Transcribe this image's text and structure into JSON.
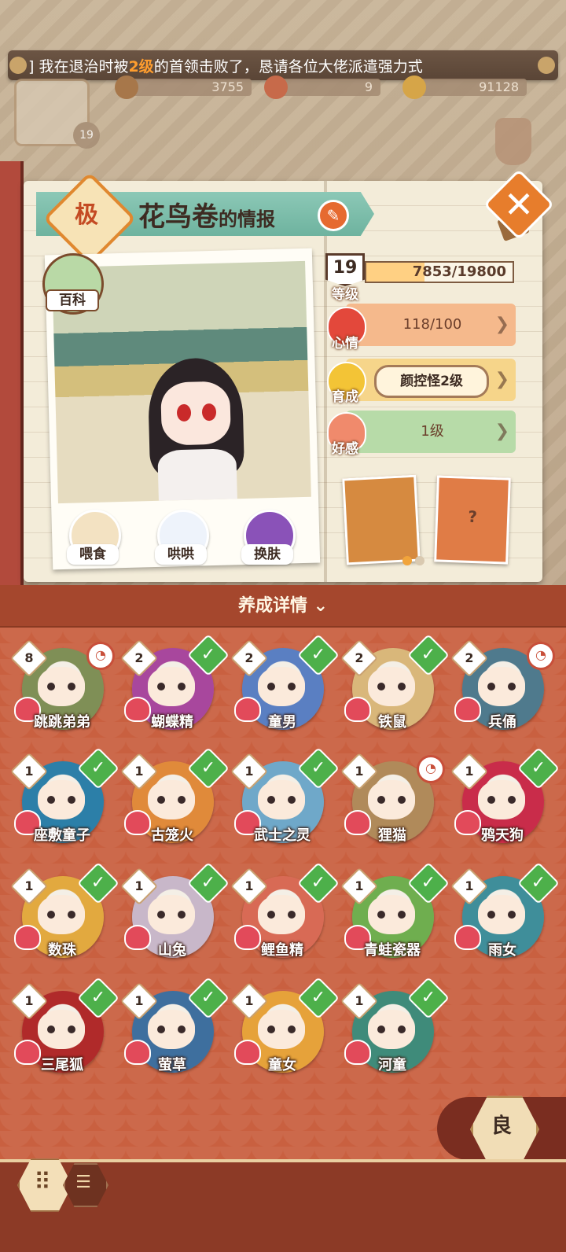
{
  "notice": {
    "prefix": "] 我在退治时被",
    "highlight": "2级",
    "suffix": "的首领击败了，恳请各位大佬派遣强力式"
  },
  "resources": {
    "food": "3755",
    "tickets": "9",
    "coins": "91128",
    "player_level": "19"
  },
  "info": {
    "grade": "极",
    "name": "花鸟卷",
    "name_suffix": "的情报",
    "edit_icon": "pencil-icon",
    "close_icon": "close-icon"
  },
  "photo": {
    "baike_label": "百科",
    "actions": [
      {
        "label": "喂食",
        "icon": "noodle-bowl-icon"
      },
      {
        "label": "哄哄",
        "icon": "milk-carton-icon"
      },
      {
        "label": "换肤",
        "icon": "skin-box-icon"
      }
    ]
  },
  "stats": {
    "level_label": "等级",
    "level": "19",
    "exp": "7853/19800",
    "exp_fraction": 0.3966,
    "mood_label": "心情",
    "mood": "118/100",
    "nurture_label": "育成",
    "nurture": "颜控怪2级",
    "affinity_label": "好感",
    "affinity": "1级"
  },
  "carousel": {
    "page": 1,
    "pages": 2
  },
  "detail_title": "养成详情",
  "shikigami": [
    {
      "name": "跳跳弟弟",
      "level": "8",
      "status": "lock",
      "color": "#7f8f56"
    },
    {
      "name": "蝴蝶精",
      "level": "2",
      "status": "check",
      "color": "#a8479d"
    },
    {
      "name": "童男",
      "level": "2",
      "status": "check",
      "color": "#5a7fc2"
    },
    {
      "name": "铁鼠",
      "level": "2",
      "status": "check",
      "color": "#d9b77a"
    },
    {
      "name": "兵俑",
      "level": "2",
      "status": "lock",
      "color": "#4f7a8d"
    },
    {
      "name": "座敷童子",
      "level": "1",
      "status": "check",
      "color": "#2c7fa8"
    },
    {
      "name": "古笼火",
      "level": "1",
      "status": "check",
      "color": "#e08a3a"
    },
    {
      "name": "武士之灵",
      "level": "1",
      "status": "check",
      "color": "#6fa8c9"
    },
    {
      "name": "狸猫",
      "level": "1",
      "status": "lock",
      "color": "#b08a5a"
    },
    {
      "name": "鸦天狗",
      "level": "1",
      "status": "check",
      "color": "#c92c4a"
    },
    {
      "name": "数珠",
      "level": "1",
      "status": "check",
      "color": "#e2a93f"
    },
    {
      "name": "山兔",
      "level": "1",
      "status": "check",
      "color": "#c8b7c9"
    },
    {
      "name": "鲤鱼精",
      "level": "1",
      "status": "check",
      "color": "#d86a55"
    },
    {
      "name": "青蛙瓷器",
      "level": "1",
      "status": "check",
      "color": "#6fae4f"
    },
    {
      "name": "雨女",
      "level": "1",
      "status": "check",
      "color": "#3f8e9a"
    },
    {
      "name": "三尾狐",
      "level": "1",
      "status": "check",
      "color": "#b02a2a"
    },
    {
      "name": "萤草",
      "level": "1",
      "status": "check",
      "color": "#3e6f9e"
    },
    {
      "name": "童女",
      "level": "1",
      "status": "check",
      "color": "#e6a23a"
    },
    {
      "name": "河童",
      "level": "1",
      "status": "check",
      "color": "#3f8b7a"
    }
  ],
  "rank_tab": "良",
  "colors": {
    "accent": "#e77d2c",
    "panel": "#cc6442",
    "check": "#4db04a",
    "mood_bar": "#f5b98c",
    "nurture_bar": "#f6d58a",
    "affinity_bar": "#b7dba8"
  }
}
